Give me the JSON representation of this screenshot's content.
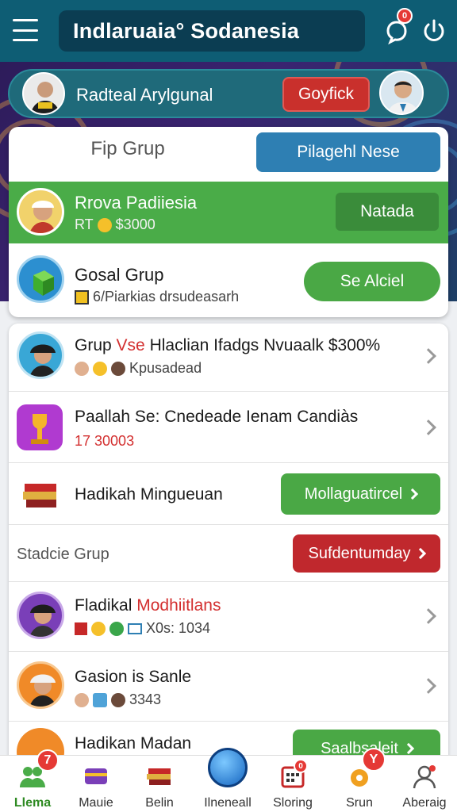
{
  "header": {
    "title": "Indlaruaia° Sodanesia",
    "notif_count": "0"
  },
  "user_bar": {
    "name": "Radteal Arylgunal",
    "button": "Goyfick"
  },
  "group_card": {
    "tab_left": "Fip Grup",
    "tab_right": "Pilagehl Nese",
    "highlight": {
      "title": "Rrova Padiiesia",
      "sub_prefix": "RT",
      "amount": "$3000",
      "button": "Natada"
    },
    "second": {
      "title": "Gosal Grup",
      "sub": "6/Piarkias drsudeasarh",
      "button": "Se Alciel"
    }
  },
  "list": {
    "item1": {
      "title_a": "Grup",
      "title_b": "Vse",
      "title_c": "Hlaclian Ifadgs Nvuaalk $300%",
      "sub": "Kpusadead"
    },
    "item2": {
      "title": "Paallah Se: Cnedeade Ienam Candiàs",
      "sub": "17 30003"
    },
    "item3": {
      "title": "Hadikah Mingueuan",
      "button": "Mollaguatircel"
    },
    "section": {
      "label": "Stadcie Grup",
      "button": "Sufdentumday"
    },
    "item4": {
      "title_a": "Fladikal",
      "title_b": "Modhiitlans",
      "sub": "X0s: 1034"
    },
    "item5": {
      "title": "Gasion is Sanle",
      "sub": "3343"
    },
    "item6": {
      "title": "Hadikan Madan",
      "button": "Saalbsaleit"
    }
  },
  "bottom_nav": [
    {
      "label": "Llema",
      "badge": "7"
    },
    {
      "label": "Mauie"
    },
    {
      "label": "Belin"
    },
    {
      "label": "Ilneneall"
    },
    {
      "label": "Sloring",
      "badge": "0"
    },
    {
      "label": "Srun",
      "badge": "Y"
    },
    {
      "label": "Aberaig"
    }
  ],
  "colors": {
    "teal": "#0e5d74",
    "green": "#4aac48",
    "red": "#c9302c",
    "blue": "#2e7fb3"
  }
}
